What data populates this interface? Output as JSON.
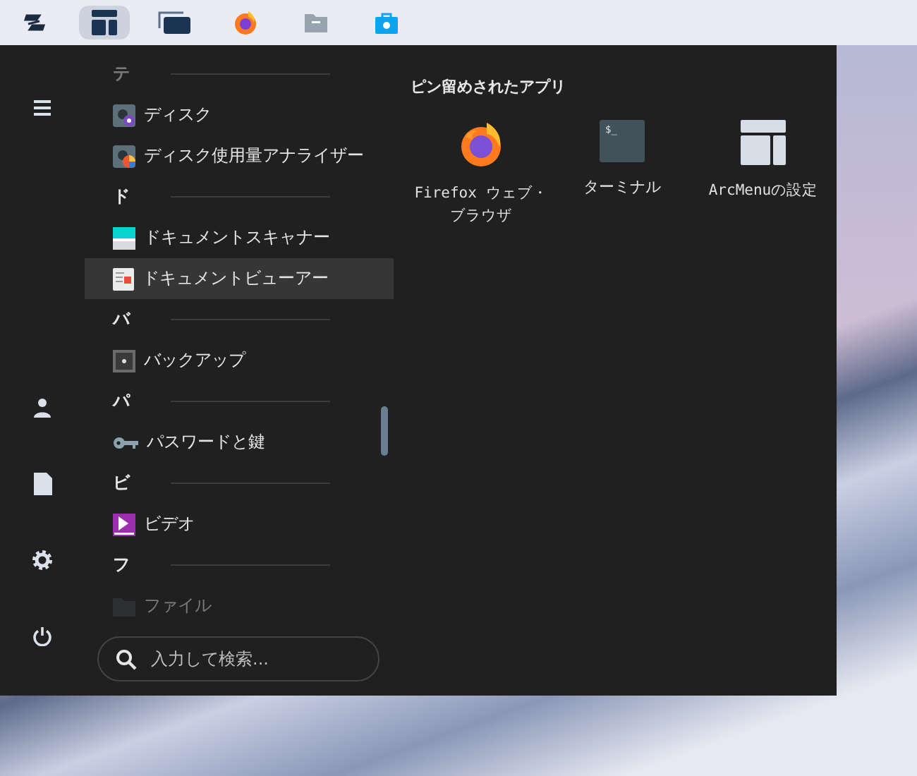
{
  "taskbar": {
    "items": [
      {
        "kind": "zorin",
        "selected": false
      },
      {
        "kind": "arcmenu",
        "selected": true
      },
      {
        "kind": "windows",
        "selected": false
      },
      {
        "kind": "firefox",
        "selected": false
      },
      {
        "kind": "files",
        "selected": false
      },
      {
        "kind": "store",
        "selected": false
      }
    ]
  },
  "menu": {
    "rail": [
      {
        "kind": "menu"
      },
      {
        "kind": "user"
      },
      {
        "kind": "document"
      },
      {
        "kind": "settings"
      },
      {
        "kind": "power"
      }
    ],
    "sections": [
      {
        "letter": "テ",
        "apps": [
          {
            "name": "ディスク",
            "kind": "disk",
            "selected": false
          },
          {
            "name": "ディスク使用量アナライザー",
            "kind": "analyzer",
            "selected": false
          }
        ]
      },
      {
        "letter": "ド",
        "apps": [
          {
            "name": "ドキュメントスキャナー",
            "kind": "scanner",
            "selected": false
          },
          {
            "name": "ドキュメントビューアー",
            "kind": "viewer",
            "selected": true
          }
        ]
      },
      {
        "letter": "バ",
        "apps": [
          {
            "name": "バックアップ",
            "kind": "backup",
            "selected": false
          }
        ]
      },
      {
        "letter": "パ",
        "apps": [
          {
            "name": "パスワードと鍵",
            "kind": "key",
            "selected": false
          }
        ]
      },
      {
        "letter": "ビ",
        "apps": [
          {
            "name": "ビデオ",
            "kind": "video",
            "selected": false
          }
        ]
      },
      {
        "letter": "フ",
        "apps": [
          {
            "name": "ファイル",
            "kind": "folder",
            "selected": false
          }
        ]
      }
    ],
    "search": {
      "placeholder": "入力して検索..."
    },
    "pinned": {
      "title": "ピン留めされたアプリ",
      "apps": [
        {
          "name": "Firefox ウェブ・ブラウザ",
          "kind": "firefox"
        },
        {
          "name": "ターミナル",
          "kind": "terminal",
          "icon_text": "$_"
        },
        {
          "name": "ArcMenuの設定",
          "kind": "arcmenu"
        }
      ]
    }
  }
}
